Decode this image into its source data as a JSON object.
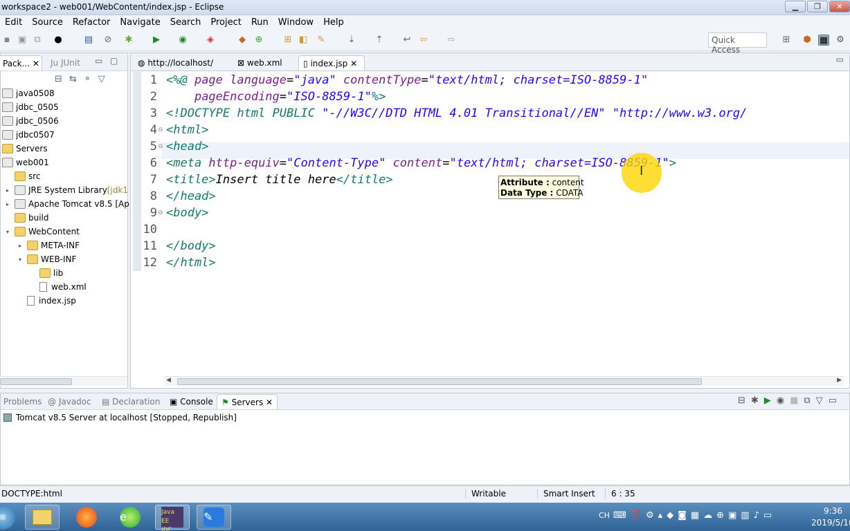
{
  "window": {
    "title": "workspace2 - web001/WebContent/index.jsp - Eclipse"
  },
  "menu": [
    "Edit",
    "Source",
    "Refactor",
    "Navigate",
    "Search",
    "Project",
    "Run",
    "Window",
    "Help"
  ],
  "toolbar": {
    "quick_access": "Quick Access"
  },
  "explorer": {
    "tabs": [
      "Pack...",
      "JUnit"
    ],
    "items": [
      {
        "label": "java0508"
      },
      {
        "label": "jdbc_0505"
      },
      {
        "label": "jdbc_0506"
      },
      {
        "label": "jdbc0507"
      },
      {
        "label": "Servers"
      },
      {
        "label": "web001"
      },
      {
        "label": "src"
      },
      {
        "label": "JRE System Library",
        "suffix": "[jdk1"
      },
      {
        "label": "Apache Tomcat v8.5 [Ap"
      },
      {
        "label": "build"
      },
      {
        "label": "WebContent"
      },
      {
        "label": "META-INF"
      },
      {
        "label": "WEB-INF"
      },
      {
        "label": "lib"
      },
      {
        "label": "web.xml"
      },
      {
        "label": "index.jsp"
      }
    ]
  },
  "editor": {
    "tabs": [
      "http://localhost/",
      "web.xml",
      "index.jsp"
    ],
    "lines": [
      [
        {
          "c": "tag",
          "t": "<%@ "
        },
        {
          "c": "attr",
          "t": "page "
        },
        {
          "c": "attr",
          "t": "language"
        },
        {
          "c": "txt",
          "t": "="
        },
        {
          "c": "val",
          "t": "\"java\" "
        },
        {
          "c": "attr",
          "t": "contentType"
        },
        {
          "c": "txt",
          "t": "="
        },
        {
          "c": "val",
          "t": "\"text/html; charset=ISO-8859-1\""
        }
      ],
      [
        {
          "c": "txt",
          "t": "    "
        },
        {
          "c": "attr",
          "t": "pageEncoding"
        },
        {
          "c": "txt",
          "t": "="
        },
        {
          "c": "val",
          "t": "\"ISO-8859-1\""
        },
        {
          "c": "tag",
          "t": "%>"
        }
      ],
      [
        {
          "c": "doct",
          "t": "<!DOCTYPE html PUBLIC "
        },
        {
          "c": "val",
          "t": "\"-//W3C//DTD HTML 4.01 Transitional//EN\" \"http://www.w3.org/"
        }
      ],
      [
        {
          "c": "tag",
          "t": "<html>"
        }
      ],
      [
        {
          "c": "tag",
          "t": "<head>"
        }
      ],
      [
        {
          "c": "tag",
          "t": "<meta "
        },
        {
          "c": "attr",
          "t": "http-equiv"
        },
        {
          "c": "txt",
          "t": "="
        },
        {
          "c": "val",
          "t": "\"Content-Type\" "
        },
        {
          "c": "attr",
          "t": "content"
        },
        {
          "c": "txt",
          "t": "="
        },
        {
          "c": "val",
          "t": "\"text/html; charset=ISO-8859-1\""
        },
        {
          "c": "tag",
          "t": ">"
        }
      ],
      [
        {
          "c": "tag",
          "t": "<title>"
        },
        {
          "c": "txt",
          "t": "Insert title here"
        },
        {
          "c": "tag",
          "t": "</title>"
        }
      ],
      [
        {
          "c": "tag",
          "t": "</head>"
        }
      ],
      [
        {
          "c": "tag",
          "t": "<body>"
        }
      ],
      [],
      [
        {
          "c": "tag",
          "t": "</body>"
        }
      ],
      [
        {
          "c": "tag",
          "t": "</html>"
        }
      ]
    ],
    "line_numbers": [
      "1",
      "2",
      "3",
      "4",
      "5",
      "6",
      "7",
      "8",
      "9",
      "10",
      "11",
      "12"
    ]
  },
  "tooltip": {
    "line1_key": "Attribute :",
    "line1_val": "content",
    "line2_key": "Data Type :",
    "line2_val": "CDATA"
  },
  "bottom": {
    "tabs": [
      "Problems",
      "Javadoc",
      "Declaration",
      "Console",
      "Servers"
    ],
    "server_row": "Tomcat v8.5 Server at localhost  [Stopped, Republish]"
  },
  "status": {
    "path": "DOCTYPE:html",
    "writable": "Writable",
    "insert": "Smart Insert",
    "position": "6 : 35"
  },
  "taskbar": {
    "time": "9:36",
    "date": "2019/5/1(",
    "lang": "CH"
  }
}
